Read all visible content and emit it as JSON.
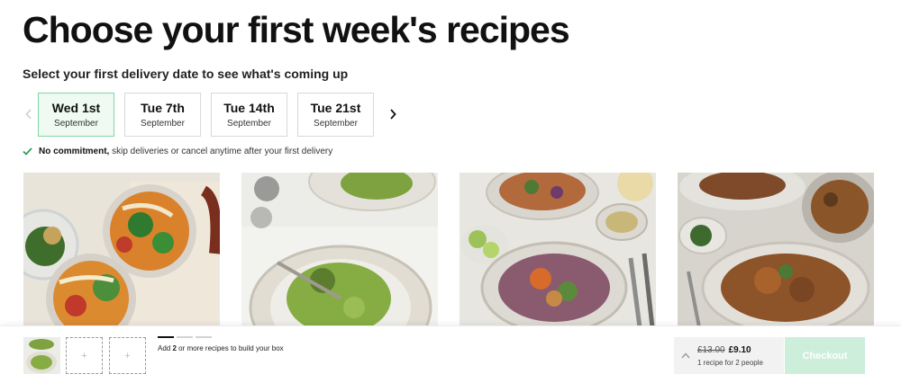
{
  "page": {
    "title": "Choose your first week's recipes",
    "subtitle": "Select your first delivery date to see what's coming up"
  },
  "dates": [
    {
      "day": "Wed 1st",
      "month": "September",
      "selected": true
    },
    {
      "day": "Tue 7th",
      "month": "September",
      "selected": false
    },
    {
      "day": "Tue 14th",
      "month": "September",
      "selected": false
    },
    {
      "day": "Tue 21st",
      "month": "September",
      "selected": false
    }
  ],
  "commitment": {
    "bold": "No commitment,",
    "text": " skip deliveries or cancel anytime after your first delivery"
  },
  "recipes": [
    {
      "image": "noodle-soup-bowls-photo"
    },
    {
      "image": "green-pesto-pasta-photo"
    },
    {
      "image": "grain-salad-photo"
    },
    {
      "image": "braised-chicken-photo"
    }
  ],
  "footer": {
    "message_prefix": "Add ",
    "message_count": "2",
    "message_suffix": " or more recipes to build your box",
    "old_price": "£13.00",
    "new_price": "£9.10",
    "price_note": "1 recipe for 2 people",
    "checkout_label": "Checkout"
  },
  "colors": {
    "selected_border": "#7fd6a4",
    "selected_bg": "#eefaf2",
    "check_green": "#2e9e5b",
    "checkout_bg": "#cdeedb"
  }
}
